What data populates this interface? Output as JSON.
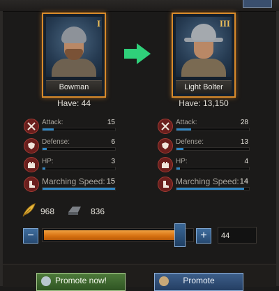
{
  "left_unit": {
    "name": "Bowman",
    "tier": "I",
    "have_label": "Have: 44",
    "stats": {
      "attack": {
        "label": "Attack:",
        "value": "15",
        "fraction": 0.15
      },
      "defense": {
        "label": "Defense:",
        "value": "6",
        "fraction": 0.06
      },
      "hp": {
        "label": "HP:",
        "value": "3",
        "fraction": 0.04
      },
      "speed": {
        "label": "Marching Speed:",
        "value": "15",
        "fraction": 1.0
      }
    }
  },
  "right_unit": {
    "name": "Light Bolter",
    "tier": "III",
    "have_label": "Have: 13,150",
    "stats": {
      "attack": {
        "label": "Attack:",
        "value": "28",
        "fraction": 0.2
      },
      "defense": {
        "label": "Defense:",
        "value": "13",
        "fraction": 0.1
      },
      "hp": {
        "label": "HP:",
        "value": "4",
        "fraction": 0.05
      },
      "speed": {
        "label": "Marching Speed:",
        "value": "14",
        "fraction": 0.93
      }
    }
  },
  "resources": {
    "feather_value": "968",
    "iron_value": "836"
  },
  "slider": {
    "minus_label": "−",
    "plus_label": "+",
    "fill_fraction": 0.92,
    "quantity": "44"
  },
  "buttons": {
    "promote_now": "Promote now!",
    "promote": "Promote"
  },
  "colors": {
    "accent_orange": "#d88a2a",
    "stat_blue": "#2f86c4",
    "arrow_green": "#2fd07a"
  }
}
